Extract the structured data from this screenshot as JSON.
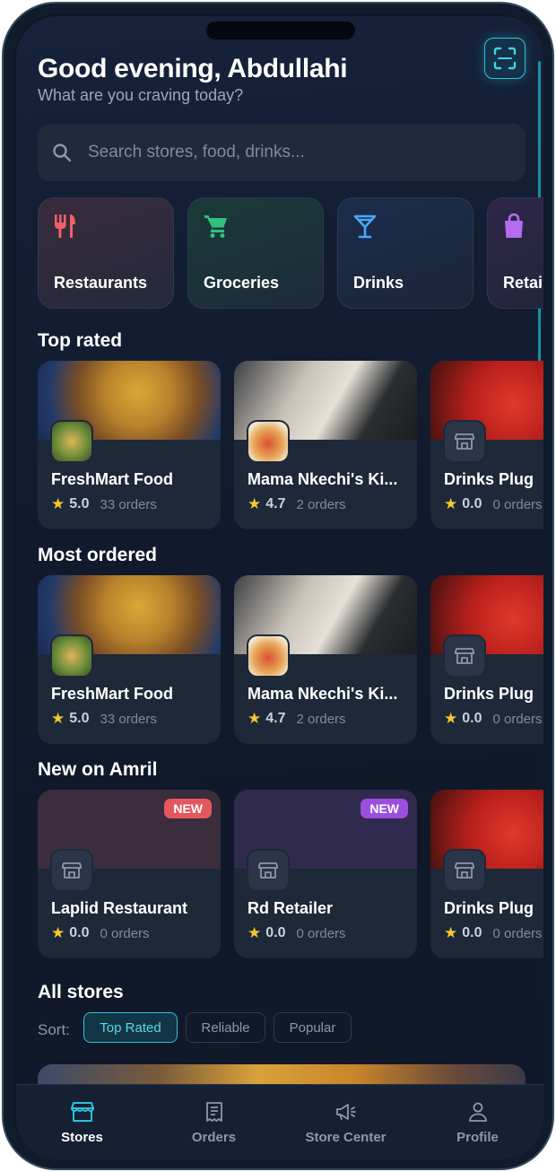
{
  "header": {
    "greeting": "Good evening, Abdullahi",
    "subtitle": "What are you craving today?"
  },
  "search": {
    "placeholder": "Search stores, food, drinks..."
  },
  "categories": [
    {
      "label": "Restaurants",
      "icon": "fork-knife-icon",
      "color": "#f0606a"
    },
    {
      "label": "Groceries",
      "icon": "cart-icon",
      "color": "#2ec27e"
    },
    {
      "label": "Drinks",
      "icon": "cocktail-icon",
      "color": "#4aa8ff"
    },
    {
      "label": "Retail",
      "icon": "shopping-bag-icon",
      "color": "#b46cf0"
    }
  ],
  "sections": {
    "top_rated": {
      "title": "Top rated",
      "stores": [
        {
          "name": "FreshMart Food",
          "rating": "5.0",
          "orders": "33 orders"
        },
        {
          "name": "Mama Nkechi's Ki...",
          "rating": "4.7",
          "orders": "2 orders"
        },
        {
          "name": "Drinks Plug",
          "rating": "0.0",
          "orders": "0 orders"
        }
      ]
    },
    "most_ordered": {
      "title": "Most ordered",
      "stores": [
        {
          "name": "FreshMart Food",
          "rating": "5.0",
          "orders": "33 orders"
        },
        {
          "name": "Mama Nkechi's Ki...",
          "rating": "4.7",
          "orders": "2 orders"
        },
        {
          "name": "Drinks Plug",
          "rating": "0.0",
          "orders": "0 orders"
        }
      ]
    },
    "new_on": {
      "title": "New on Amril",
      "stores": [
        {
          "name": "Laplid Restaurant",
          "rating": "0.0",
          "orders": "0 orders",
          "badge": "NEW",
          "badge_color": "#e5575f"
        },
        {
          "name": "Rd Retailer",
          "rating": "0.0",
          "orders": "0 orders",
          "badge": "NEW",
          "badge_color": "#9b4fe0"
        },
        {
          "name": "Drinks Plug",
          "rating": "0.0",
          "orders": "0 orders"
        }
      ]
    },
    "all_stores": {
      "title": "All stores",
      "sort_label": "Sort:",
      "sort_options": [
        "Top Rated",
        "Reliable",
        "Popular"
      ],
      "selected_sort": "Top Rated"
    }
  },
  "nav": [
    {
      "label": "Stores",
      "icon": "storefront-icon",
      "active": true
    },
    {
      "label": "Orders",
      "icon": "receipt-icon",
      "active": false
    },
    {
      "label": "Store Center",
      "icon": "megaphone-icon",
      "active": false
    },
    {
      "label": "Profile",
      "icon": "person-icon",
      "active": false
    }
  ],
  "colors": {
    "accent": "#2bc3d9",
    "background": "#111a2c",
    "card": "#1d2839",
    "star": "#f7c72d"
  }
}
